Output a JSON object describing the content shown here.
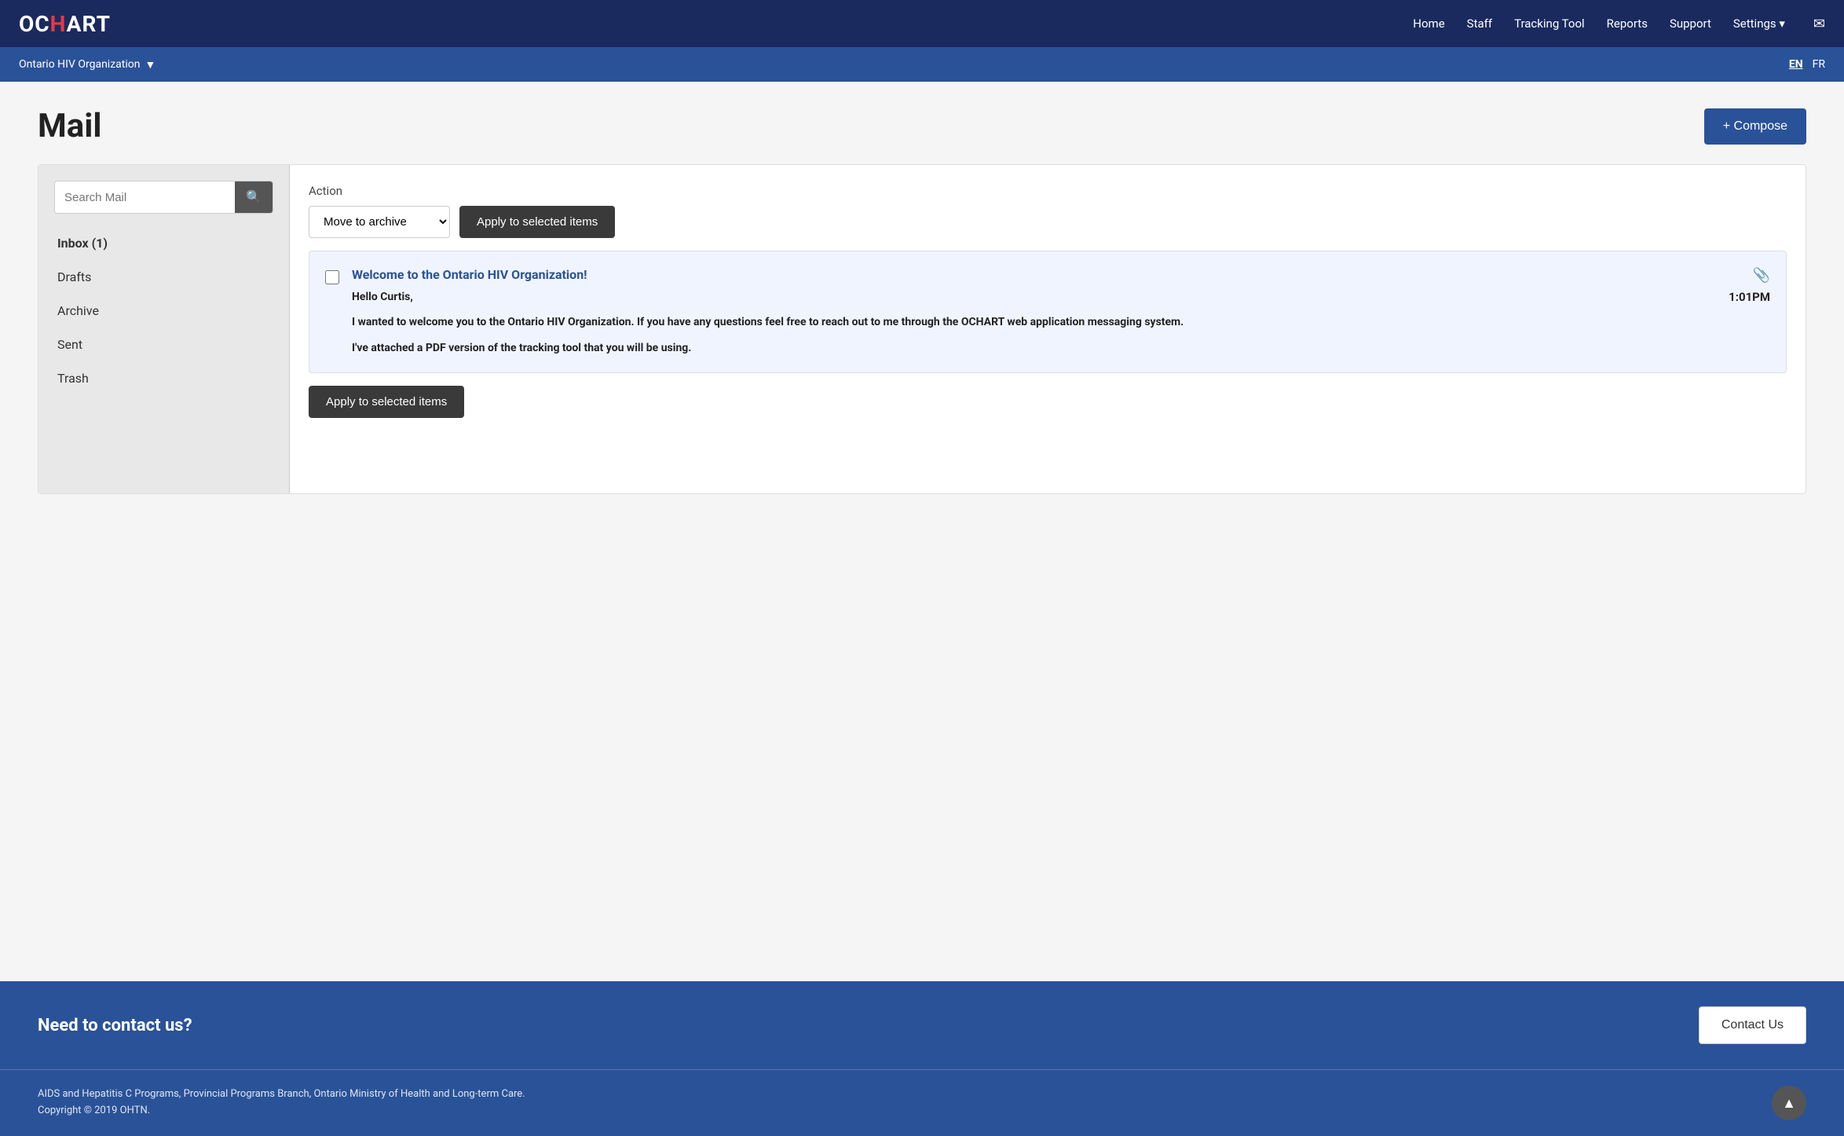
{
  "nav": {
    "logo": "OCHART",
    "links": [
      "Home",
      "Staff",
      "Tracking Tool",
      "Reports",
      "Support",
      "Settings ▾"
    ],
    "envelope_label": "✉"
  },
  "subnav": {
    "org_name": "Ontario HIV Organization",
    "lang_en": "EN",
    "lang_fr": "FR"
  },
  "page": {
    "title": "Mail",
    "compose_label": "+ Compose"
  },
  "sidebar": {
    "search_placeholder": "Search Mail",
    "search_btn_label": "🔍",
    "nav_items": [
      {
        "label": "Inbox (1)",
        "active": true
      },
      {
        "label": "Drafts",
        "active": false
      },
      {
        "label": "Archive",
        "active": false
      },
      {
        "label": "Sent",
        "active": false
      },
      {
        "label": "Trash",
        "active": false
      }
    ]
  },
  "action_bar": {
    "label": "Action",
    "select_option": "Move to archive",
    "apply_label_top": "Apply to selected items",
    "apply_label_bottom": "Apply to selected items"
  },
  "email": {
    "subject": "Welcome to the Ontario HIV Organization!",
    "greeting": "Hello Curtis,",
    "body_line1": "I wanted to welcome you to the Ontario HIV Organization. If you have any questions feel free to reach out to me through the OCHART web application messaging system.",
    "body_line2": "I've attached a PDF version of the tracking tool that you will be using.",
    "time": "1:01PM",
    "attachment_icon": "📎"
  },
  "footer": {
    "contact_heading": "Need to contact us?",
    "contact_btn": "Contact Us",
    "copy_line1": "AIDS and Hepatitis C Programs, Provincial Programs Branch, Ontario Ministry of Health and Long-term Care.",
    "copy_line2": "Copyright © 2019 OHTN.",
    "scroll_top_icon": "▲"
  }
}
